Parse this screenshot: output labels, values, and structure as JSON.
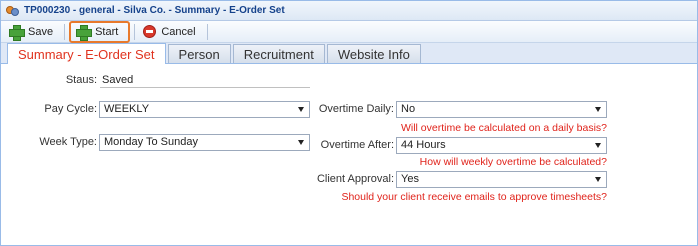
{
  "window": {
    "title": "TP000230 - general - Silva Co. - Summary - E-Order Set"
  },
  "toolbar": {
    "save_label": "Save",
    "start_label": "Start",
    "cancel_label": "Cancel"
  },
  "tabs": [
    {
      "label": "Summary - E-Order Set",
      "active": true
    },
    {
      "label": "Person",
      "active": false
    },
    {
      "label": "Recruitment",
      "active": false
    },
    {
      "label": "Website Info",
      "active": false
    }
  ],
  "form": {
    "status": {
      "label": "Staus:",
      "value": "Saved"
    },
    "pay_cycle": {
      "label": "Pay Cycle:",
      "value": "WEEKLY"
    },
    "week_type": {
      "label": "Week Type:",
      "value": "Monday To Sunday"
    },
    "overtime_daily": {
      "label": "Overtime Daily:",
      "value": "No",
      "hint": "Will overtime be calculated on a daily basis?"
    },
    "overtime_after": {
      "label": "Overtime After:",
      "value": "44 Hours",
      "hint": "How will weekly overtime be calculated?"
    },
    "client_approval": {
      "label": "Client Approval:",
      "value": "Yes",
      "hint": "Should your client receive emails to approve timesheets?"
    }
  },
  "colors": {
    "accent_tab": "#e0331f",
    "hint_text": "#e0231b",
    "highlight_border": "#e8792b"
  }
}
